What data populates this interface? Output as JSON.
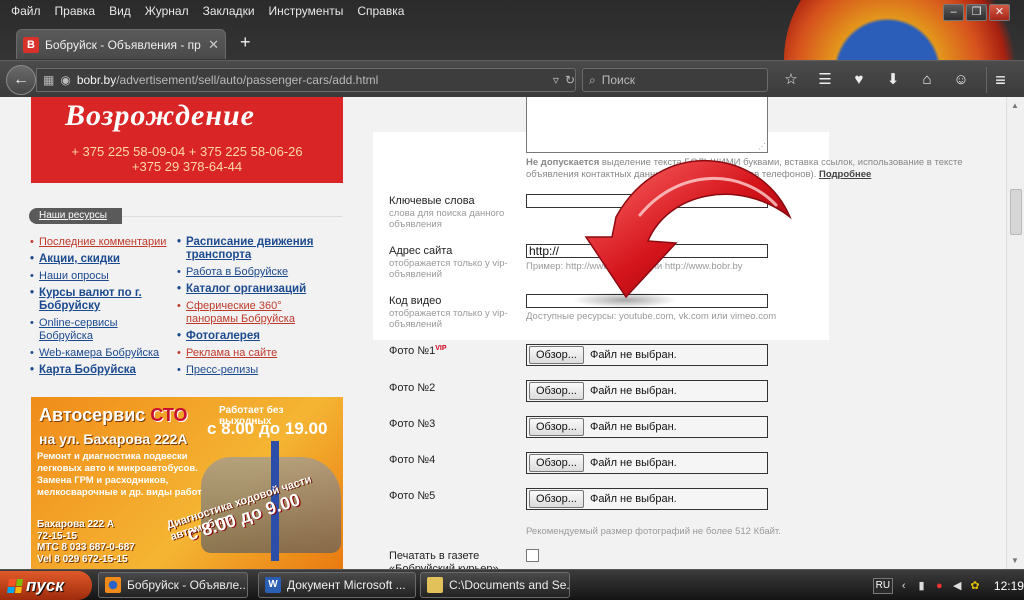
{
  "browser": {
    "menu": [
      "Файл",
      "Правка",
      "Вид",
      "Журнал",
      "Закладки",
      "Инструменты",
      "Справка"
    ],
    "tab_title": "Бобруйск - Объявления - пр...",
    "url_host": "bobr.by",
    "url_path": "/advertisement/sell/auto/passenger-cars/add.html",
    "search_placeholder": "Поиск"
  },
  "sidebar": {
    "ad_company": {
      "name": "Возрождение",
      "phones": [
        "+ 375 225 58-09-04   + 375 225 58-06-26",
        "+375 29 378-64-44"
      ]
    },
    "resources_button": "Наши ресурсы",
    "links_left": [
      {
        "label": "Последние комментарии",
        "style": "red"
      },
      {
        "label": "Акции, скидки",
        "style": "bold"
      },
      {
        "label": "Наши опросы",
        "style": "blue"
      },
      {
        "label": "Курсы валют по г. Бобруйску",
        "style": "bold"
      },
      {
        "label": "Online-сервисы Бобруйска",
        "style": "blue"
      },
      {
        "label": "Web-камера Бобруйска",
        "style": "blue"
      },
      {
        "label": "Карта Бобруйска",
        "style": "bold"
      }
    ],
    "links_right": [
      {
        "label": "Расписание движения транспорта",
        "style": "bold"
      },
      {
        "label": "Работа в Бобруйске",
        "style": "blue"
      },
      {
        "label": "Каталог организаций",
        "style": "bold"
      },
      {
        "label": "Сферические 360° панорамы Бобруйска",
        "style": "red"
      },
      {
        "label": "Фотогалерея",
        "style": "bold"
      },
      {
        "label": "Реклама на сайте",
        "style": "red"
      },
      {
        "label": "Пресс-релизы",
        "style": "blue"
      }
    ],
    "ad_service": {
      "title_prefix": "Автосервис",
      "title_highlight": "СТО",
      "work_note": "Работает без выходных",
      "hours": "с 8.00 до 19.00",
      "address": "на ул. Бахарова 222А",
      "description": "Ремонт и диагностика подвески легковых авто и микроавтобусов. Замена ГРМ и расходников, мелкосварочные и др. виды работ",
      "diag_note": "Диагностика ходовой части автомобиля",
      "diag_hours": "с 8.00 до 9.00",
      "contacts": [
        "Бахарова 222 А",
        "72-15-15",
        "МТС 8 033 687-0-687",
        "Vel 8 029 672-15-15"
      ]
    }
  },
  "form": {
    "warning_bold": "Не допускается",
    "warning_text": " выделение текста БОЛЬШИМИ буквами, вставка ссылок, использование в тексте объявления контактных данных (например, номеров телефонов).",
    "warning_more": "Подробнее",
    "keywords_label": "Ключевые слова",
    "keywords_hint": "слова для поиска данного объявления",
    "keywords_value": "",
    "site_label": "Адрес сайта",
    "site_hint": "отображается только у vip-объявлений",
    "site_value": "http://",
    "site_example": "Пример: http://www.bobr.by или http://www.bobr.by",
    "video_label": "Код видео",
    "video_hint": "отображается только у vip-объявлений",
    "video_value": "",
    "video_resources": "Доступные ресурсы: youtube.com, vk.com или vimeo.com",
    "vip_tag": "VIP",
    "photos": [
      {
        "label": "Фото №1",
        "button": "Обзор...",
        "status": "Файл не выбран."
      },
      {
        "label": "Фото №2",
        "button": "Обзор...",
        "status": "Файл не выбран."
      },
      {
        "label": "Фото №3",
        "button": "Обзор...",
        "status": "Файл не выбран."
      },
      {
        "label": "Фото №4",
        "button": "Обзор...",
        "status": "Файл не выбран."
      },
      {
        "label": "Фото №5",
        "button": "Обзор...",
        "status": "Файл не выбран."
      }
    ],
    "photo_recommendation": "Рекомендуемый размер фотографий не более 512 Кбайт.",
    "print_label": "Печатать в газете «Бобруйский курьер»",
    "print_checked": false
  },
  "taskbar": {
    "start_label": "пуск",
    "tasks": [
      "Бобруйск - Объявле...",
      "Документ Microsoft ...",
      "C:\\Documents and Se..."
    ],
    "lang": "RU",
    "time": "12:19"
  },
  "colors": {
    "arrow_red": "#d4141b",
    "ad_red": "#d92525",
    "link_blue": "#1c4a8f",
    "link_red": "#c0392b"
  }
}
